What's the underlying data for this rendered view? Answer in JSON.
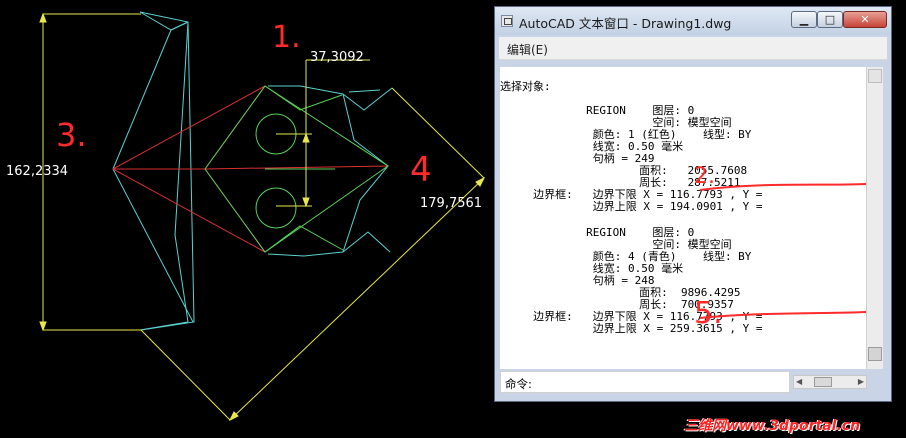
{
  "drawing": {
    "dim_top": "37,3092",
    "dim_left": "162,2334",
    "dim_right": "179,7561"
  },
  "annotations": {
    "note1": "1.",
    "note3": "3.",
    "note4": "4",
    "note2": "2.",
    "note5": "5."
  },
  "text_window": {
    "title": "AutoCAD 文本窗口 - Drawing1.dwg",
    "minimize_label": "▁",
    "maximize_label": "□",
    "close_label": "✕",
    "menu_edit": "编辑(E)",
    "lines": [
      "选择对象:",
      "",
      "             REGION    图层: 0",
      "                       空间: 模型空间",
      "              颜色: 1 (红色)    线型: BY",
      "              线宽: 0.50 毫米",
      "              句柄 = 249",
      "                     面积:   2055.7608",
      "                     周长:   287.5211",
      "     边界框:   边界下限 X = 116.7793 , Y =",
      "              边界上限 X = 194.0901 , Y =",
      "",
      "             REGION    图层: 0",
      "                       空间: 模型空间",
      "              颜色: 4 (青色)    线型: BY",
      "              线宽: 0.50 毫米",
      "              句柄 = 248",
      "                     面积:  9896.4295",
      "                     周长:  700.9357",
      "     边界框:   边界下限 X = 116.7793 , Y =",
      "              边界上限 X = 259.3615 , Y ="
    ],
    "command_label": "命令:"
  },
  "watermark": "三维网www.3dportal.cn",
  "colors": {
    "yellow": "#e8e84a",
    "cyan": "#5ad2d2",
    "red": "#d83030",
    "green": "#5ad25a",
    "annotation_red": "#ff2a2a"
  }
}
